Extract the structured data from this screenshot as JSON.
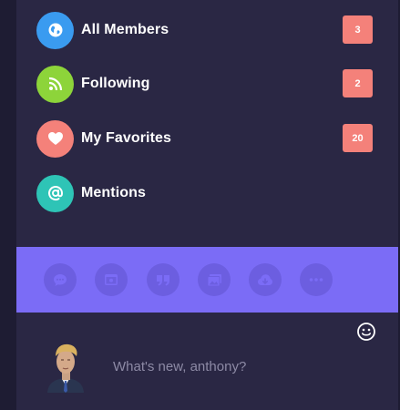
{
  "nav": {
    "items": [
      {
        "label": "All Members",
        "badge": "3",
        "icon": "globe-icon",
        "color": "#3a9bf0"
      },
      {
        "label": "Following",
        "badge": "2",
        "icon": "rss-icon",
        "color": "#8dd43a"
      },
      {
        "label": "My Favorites",
        "badge": "20",
        "icon": "heart-icon",
        "color": "#f4817a"
      },
      {
        "label": "Mentions",
        "badge": "",
        "icon": "at-icon",
        "color": "#2ec4b6"
      }
    ]
  },
  "toolbar": {
    "background": "#7b6cf6",
    "buttons": [
      "chat-icon",
      "browser-icon",
      "quote-icon",
      "gallery-icon",
      "cloud-upload-icon",
      "more-icon"
    ]
  },
  "composer": {
    "placeholder": "What's new, anthony?",
    "emoji_icon": "smiley-icon"
  },
  "colors": {
    "panel": "#2a2744",
    "badge": "#f4817a"
  }
}
